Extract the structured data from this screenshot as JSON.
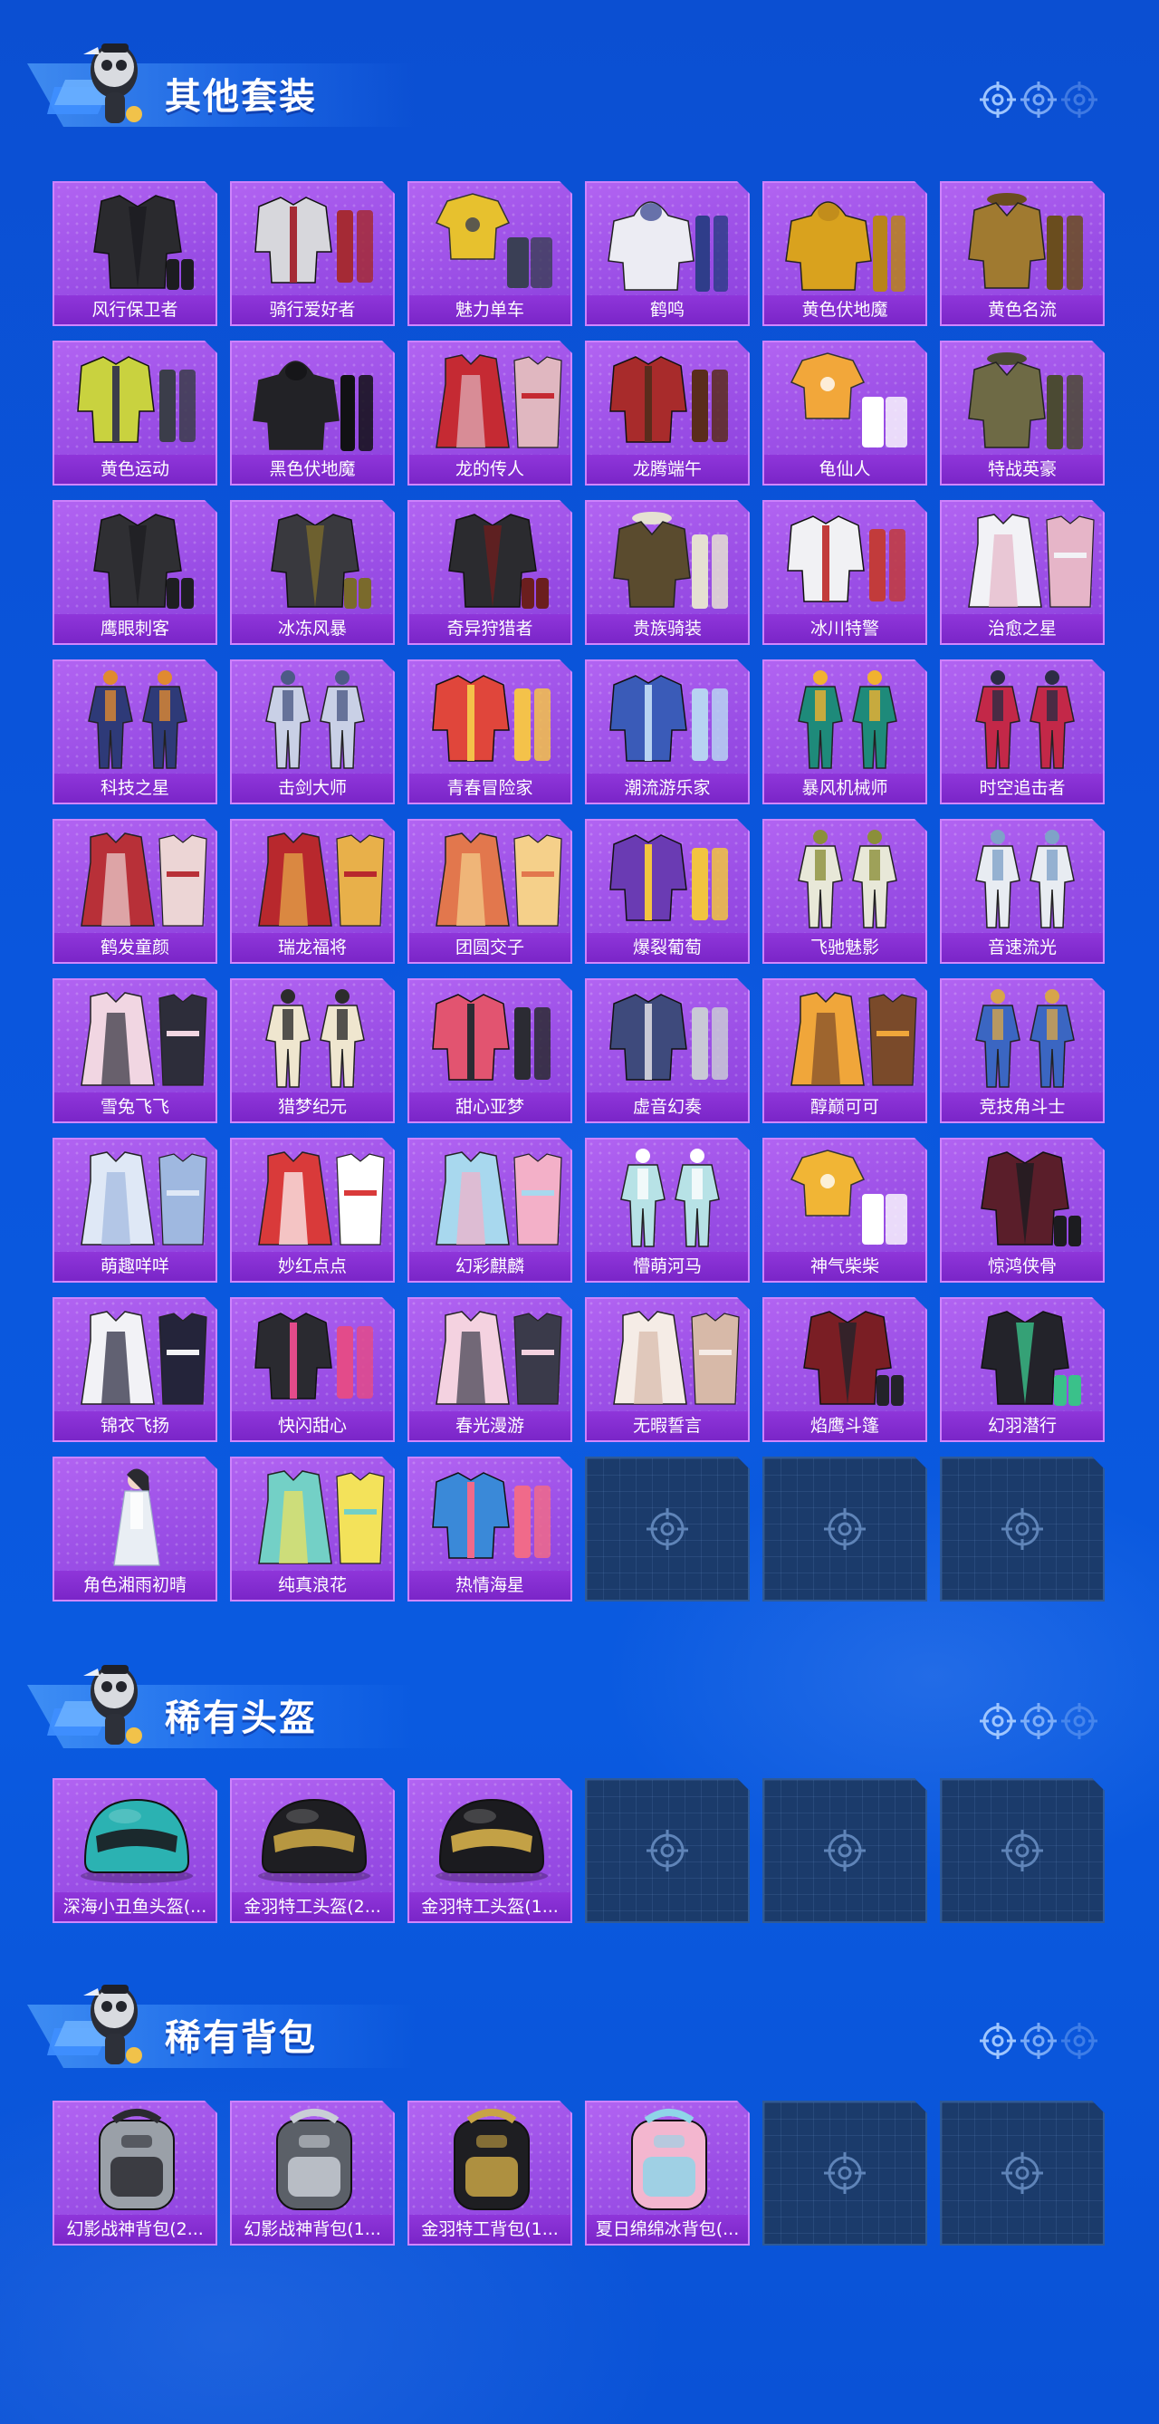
{
  "sections": [
    {
      "title": "其他套装",
      "items": [
        {
          "label": "风行保卫者",
          "kind": "coat",
          "c1": "#2a2a2e",
          "c2": "#1c1c20"
        },
        {
          "label": "骑行爱好者",
          "kind": "jacket",
          "c1": "#d7d7dc",
          "c2": "#a52a35"
        },
        {
          "label": "魅力单车",
          "kind": "tee",
          "c1": "#e7c12e",
          "c2": "#3a3f55"
        },
        {
          "label": "鹤鸣",
          "kind": "hoodie",
          "c1": "#ececf3",
          "c2": "#2f3d8a"
        },
        {
          "label": "黄色伏地魔",
          "kind": "hoodie",
          "c1": "#d9a21e",
          "c2": "#b8841a"
        },
        {
          "label": "黄色名流",
          "kind": "suit",
          "c1": "#a07a30",
          "c2": "#6a4d1e"
        },
        {
          "label": "黄色运动",
          "kind": "jacket",
          "c1": "#c9d23f",
          "c2": "#3b3d4a"
        },
        {
          "label": "黑色伏地魔",
          "kind": "hoodie",
          "c1": "#222226",
          "c2": "#111114"
        },
        {
          "label": "龙的传人",
          "kind": "dress",
          "c1": "#c52a33",
          "c2": "#e0b7c0"
        },
        {
          "label": "龙腾端午",
          "kind": "jacket",
          "c1": "#a82b2b",
          "c2": "#5a2c1c"
        },
        {
          "label": "龟仙人",
          "kind": "tee",
          "c1": "#f2a73a",
          "c2": "#ffffff"
        },
        {
          "label": "特战英豪",
          "kind": "suit",
          "c1": "#6e6a45",
          "c2": "#4b4a33"
        },
        {
          "label": "鹰眼刺客",
          "kind": "coat",
          "c1": "#2f2f33",
          "c2": "#1e1e22"
        },
        {
          "label": "冰冻风暴",
          "kind": "coat",
          "c1": "#39393e",
          "c2": "#7a6a2c"
        },
        {
          "label": "奇异狩猎者",
          "kind": "coat",
          "c1": "#2b2b2f",
          "c2": "#6b1e1e"
        },
        {
          "label": "贵族骑装",
          "kind": "suit",
          "c1": "#5a4b2e",
          "c2": "#e5e0d2"
        },
        {
          "label": "冰川特警",
          "kind": "jacket",
          "c1": "#f1f1f4",
          "c2": "#c23b3b"
        },
        {
          "label": "治愈之星",
          "kind": "dress",
          "c1": "#f2f2f6",
          "c2": "#e6b5c8"
        },
        {
          "label": "科技之星",
          "kind": "bodysuit",
          "c1": "#2e3a78",
          "c2": "#e08a30"
        },
        {
          "label": "击剑大师",
          "kind": "bodysuit",
          "c1": "#c9d0e6",
          "c2": "#4d5a86"
        },
        {
          "label": "青春冒险家",
          "kind": "jacket",
          "c1": "#e0463b",
          "c2": "#f4c24a"
        },
        {
          "label": "潮流游乐家",
          "kind": "jacket",
          "c1": "#3a5bb8",
          "c2": "#b7d3f2"
        },
        {
          "label": "暴风机械师",
          "kind": "bodysuit",
          "c1": "#1e8a7a",
          "c2": "#f1b230"
        },
        {
          "label": "时空追击者",
          "kind": "bodysuit",
          "c1": "#c32848",
          "c2": "#2c2c44"
        },
        {
          "label": "鹤发童颜",
          "kind": "dress",
          "c1": "#b83038",
          "c2": "#ecd5d5"
        },
        {
          "label": "瑞龙福将",
          "kind": "dress",
          "c1": "#b8282d",
          "c2": "#e8b04a"
        },
        {
          "label": "团圆交子",
          "kind": "dress",
          "c1": "#e2774d",
          "c2": "#f5d08a"
        },
        {
          "label": "爆裂葡萄",
          "kind": "jacket",
          "c1": "#6a3bb3",
          "c2": "#f2c440"
        },
        {
          "label": "飞驰魅影",
          "kind": "bodysuit",
          "c1": "#e8e8d8",
          "c2": "#8b8f3a"
        },
        {
          "label": "音速流光",
          "kind": "bodysuit",
          "c1": "#e8ecf2",
          "c2": "#7fa2c8"
        },
        {
          "label": "雪兔飞飞",
          "kind": "dress",
          "c1": "#f1d6e2",
          "c2": "#2d2d3a"
        },
        {
          "label": "猎梦纪元",
          "kind": "bodysuit",
          "c1": "#efe6cf",
          "c2": "#2c2c2c"
        },
        {
          "label": "甜心亚梦",
          "kind": "jacket",
          "c1": "#e25470",
          "c2": "#2b2b33"
        },
        {
          "label": "虚音幻奏",
          "kind": "jacket",
          "c1": "#3e4a7c",
          "c2": "#c9c9d6"
        },
        {
          "label": "醇巅可可",
          "kind": "dress",
          "c1": "#f0a63a",
          "c2": "#7a4a2a"
        },
        {
          "label": "竞技角斗士",
          "kind": "bodysuit",
          "c1": "#3b66c2",
          "c2": "#d7a54a"
        },
        {
          "label": "萌趣咩咩",
          "kind": "dress",
          "c1": "#dfe8f6",
          "c2": "#9fb8e0"
        },
        {
          "label": "妙红点点",
          "kind": "dress",
          "c1": "#d93a3a",
          "c2": "#ffffff"
        },
        {
          "label": "幻彩麒麟",
          "kind": "dress",
          "c1": "#a8d8ee",
          "c2": "#f3b0c8"
        },
        {
          "label": "懵萌河马",
          "kind": "bodysuit",
          "c1": "#b7e2e6",
          "c2": "#ffffff"
        },
        {
          "label": "神气柴柴",
          "kind": "tee",
          "c1": "#f1b535",
          "c2": "#ffffff"
        },
        {
          "label": "惊鸿侠骨",
          "kind": "coat",
          "c1": "#5a1e2a",
          "c2": "#1c1c20"
        },
        {
          "label": "锦衣飞扬",
          "kind": "dress",
          "c1": "#f2f2f6",
          "c2": "#24243a"
        },
        {
          "label": "快闪甜心",
          "kind": "jacket",
          "c1": "#2a2a30",
          "c2": "#e34b8a"
        },
        {
          "label": "春光漫游",
          "kind": "dress",
          "c1": "#f4d2e0",
          "c2": "#3a3a4a"
        },
        {
          "label": "无暇誓言",
          "kind": "dress",
          "c1": "#f5ece6",
          "c2": "#d7b9a8"
        },
        {
          "label": "焰鹰斗篷",
          "kind": "coat",
          "c1": "#7a1e24",
          "c2": "#23232a"
        },
        {
          "label": "幻羽潜行",
          "kind": "coat",
          "c1": "#23232a",
          "c2": "#3ac18a"
        },
        {
          "label": "角色湘雨初晴",
          "kind": "figure",
          "c1": "#e9eef4",
          "c2": "#2a2a30"
        },
        {
          "label": "纯真浪花",
          "kind": "dress",
          "c1": "#73d0c6",
          "c2": "#f3e25a"
        },
        {
          "label": "热情海星",
          "kind": "jacket",
          "c1": "#3a89d8",
          "c2": "#f06a8a"
        },
        {
          "empty": true
        },
        {
          "empty": true
        },
        {
          "empty": true
        }
      ]
    },
    {
      "title": "稀有头盔",
      "items": [
        {
          "label": "深海小丑鱼头盔(...",
          "kind": "helmet",
          "c1": "#2bb2b2",
          "c2": "#1a1a1e"
        },
        {
          "label": "金羽特工头盔(2...",
          "kind": "helmet",
          "c1": "#1e1e22",
          "c2": "#c8a445"
        },
        {
          "label": "金羽特工头盔(1...",
          "kind": "helmet",
          "c1": "#1b1b1f",
          "c2": "#d6b04a"
        },
        {
          "empty": true
        },
        {
          "empty": true
        },
        {
          "empty": true
        }
      ]
    },
    {
      "title": "稀有背包",
      "items": [
        {
          "label": "幻影战神背包(2...",
          "kind": "backpack",
          "c1": "#9aa0a8",
          "c2": "#2a2a30"
        },
        {
          "label": "幻影战神背包(1...",
          "kind": "backpack",
          "c1": "#5b6068",
          "c2": "#c9ced6"
        },
        {
          "label": "金羽特工背包(1...",
          "kind": "backpack",
          "c1": "#1e1e22",
          "c2": "#c8a445"
        },
        {
          "label": "夏日绵绵冰背包(...",
          "kind": "backpack",
          "c1": "#f3b6cf",
          "c2": "#8fd5e8"
        },
        {
          "empty": true
        },
        {
          "empty": true
        }
      ]
    }
  ]
}
